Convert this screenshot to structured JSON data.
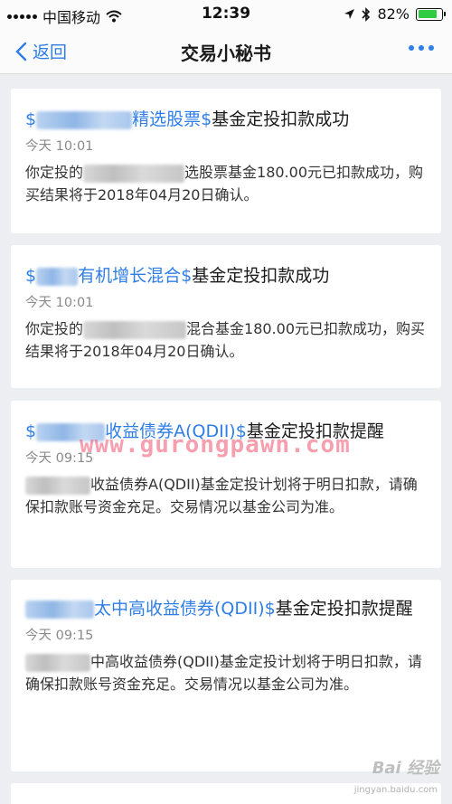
{
  "status_bar": {
    "carrier": "中国移动",
    "time": "12:39",
    "battery": "82%",
    "battery_level": 0.82
  },
  "nav": {
    "back_label": "返回",
    "title": "交易小秘书"
  },
  "messages": [
    {
      "title_prefix": "$",
      "title_fund": "精选股票$",
      "title_suffix": "基金定投扣款成功",
      "time": "今天 10:01",
      "body_lead": "你定投的",
      "body_tail": "选股票基金180.00元已扣款成功，购买结果将于2018年04月20日确认。"
    },
    {
      "title_prefix": "$",
      "title_fund": "有机增长混合$",
      "title_suffix": "基金定投扣款成功",
      "time": "今天 10:01",
      "body_lead": "你定投的",
      "body_tail": "混合基金180.00元已扣款成功，购买结果将于2018年04月20日确认。"
    },
    {
      "title_prefix": "$",
      "title_fund": "收益债券A(QDII)$",
      "title_suffix": "基金定投扣款提醒",
      "time": "今天 09:15",
      "body_tail": "收益债券A(QDII)基金定投计划将于明日扣款，请确保扣款账号资金充足。交易情况以基金公司为准。"
    },
    {
      "title_prefix": "",
      "title_fund": "太中高收益债券(QDII)$",
      "title_suffix": "基金定投扣款提醒",
      "time": "今天 09:15",
      "body_tail": "中高收益债券(QDII)基金定投计划将于明日扣款，请确保扣款账号资金充足。交易情况以基金公司为准。"
    }
  ],
  "watermark": "www.gurongpawn.com",
  "baidu_watermark": "Bai 经验",
  "baidu_url": "jingyan.baidu.com"
}
